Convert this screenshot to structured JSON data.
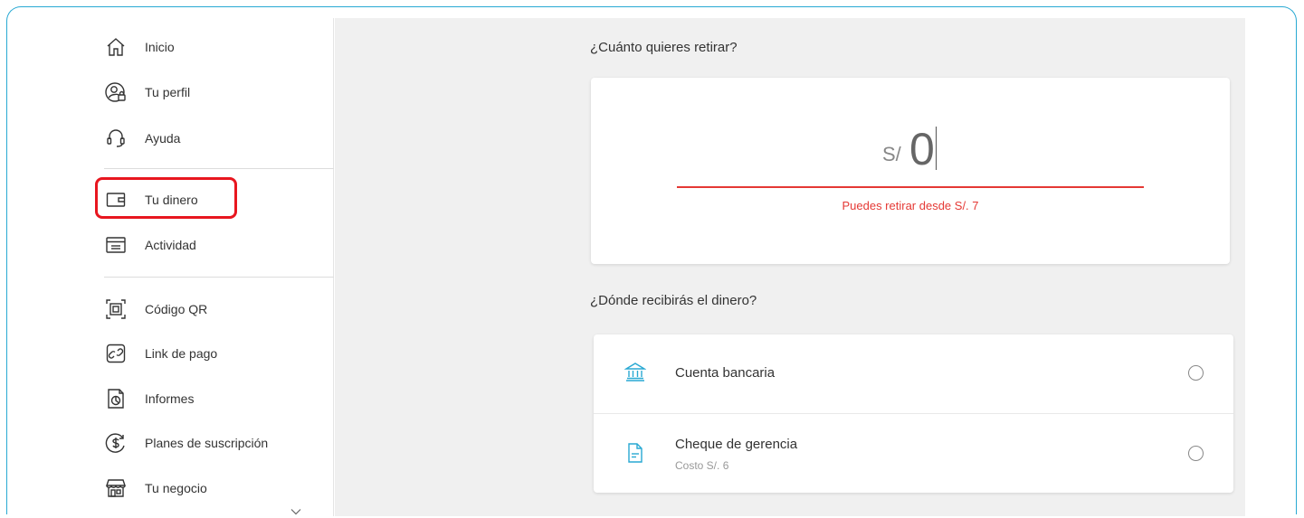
{
  "sidebar": {
    "items": [
      {
        "label": "Inicio",
        "icon": "home-icon"
      },
      {
        "label": "Tu perfil",
        "icon": "user-lock-icon"
      },
      {
        "label": "Ayuda",
        "icon": "headset-icon"
      },
      {
        "label": "Tu dinero",
        "icon": "wallet-icon"
      },
      {
        "label": "Actividad",
        "icon": "list-icon"
      },
      {
        "label": "Código QR",
        "icon": "qr-code-icon"
      },
      {
        "label": "Link de pago",
        "icon": "link-icon"
      },
      {
        "label": "Informes",
        "icon": "report-icon"
      },
      {
        "label": "Planes de suscripción",
        "icon": "dollar-circle-icon"
      },
      {
        "label": "Tu negocio",
        "icon": "store-icon"
      }
    ]
  },
  "withdraw": {
    "question": "¿Cuánto quieres retirar?",
    "currency": "S/",
    "amount": "0",
    "error": "Puedes retirar desde S/. 7"
  },
  "destination": {
    "question": "¿Dónde recibirás el dinero?",
    "options": [
      {
        "title": "Cuenta bancaria",
        "subtitle": "",
        "icon": "bank-icon"
      },
      {
        "title": "Cheque de gerencia",
        "subtitle": "Costo S/. 6",
        "icon": "document-icon"
      }
    ]
  },
  "colors": {
    "accent_blue": "#29a9d3",
    "error_red": "#e53935",
    "highlight_red": "#e8161f",
    "main_bg": "#f0f0f0"
  }
}
